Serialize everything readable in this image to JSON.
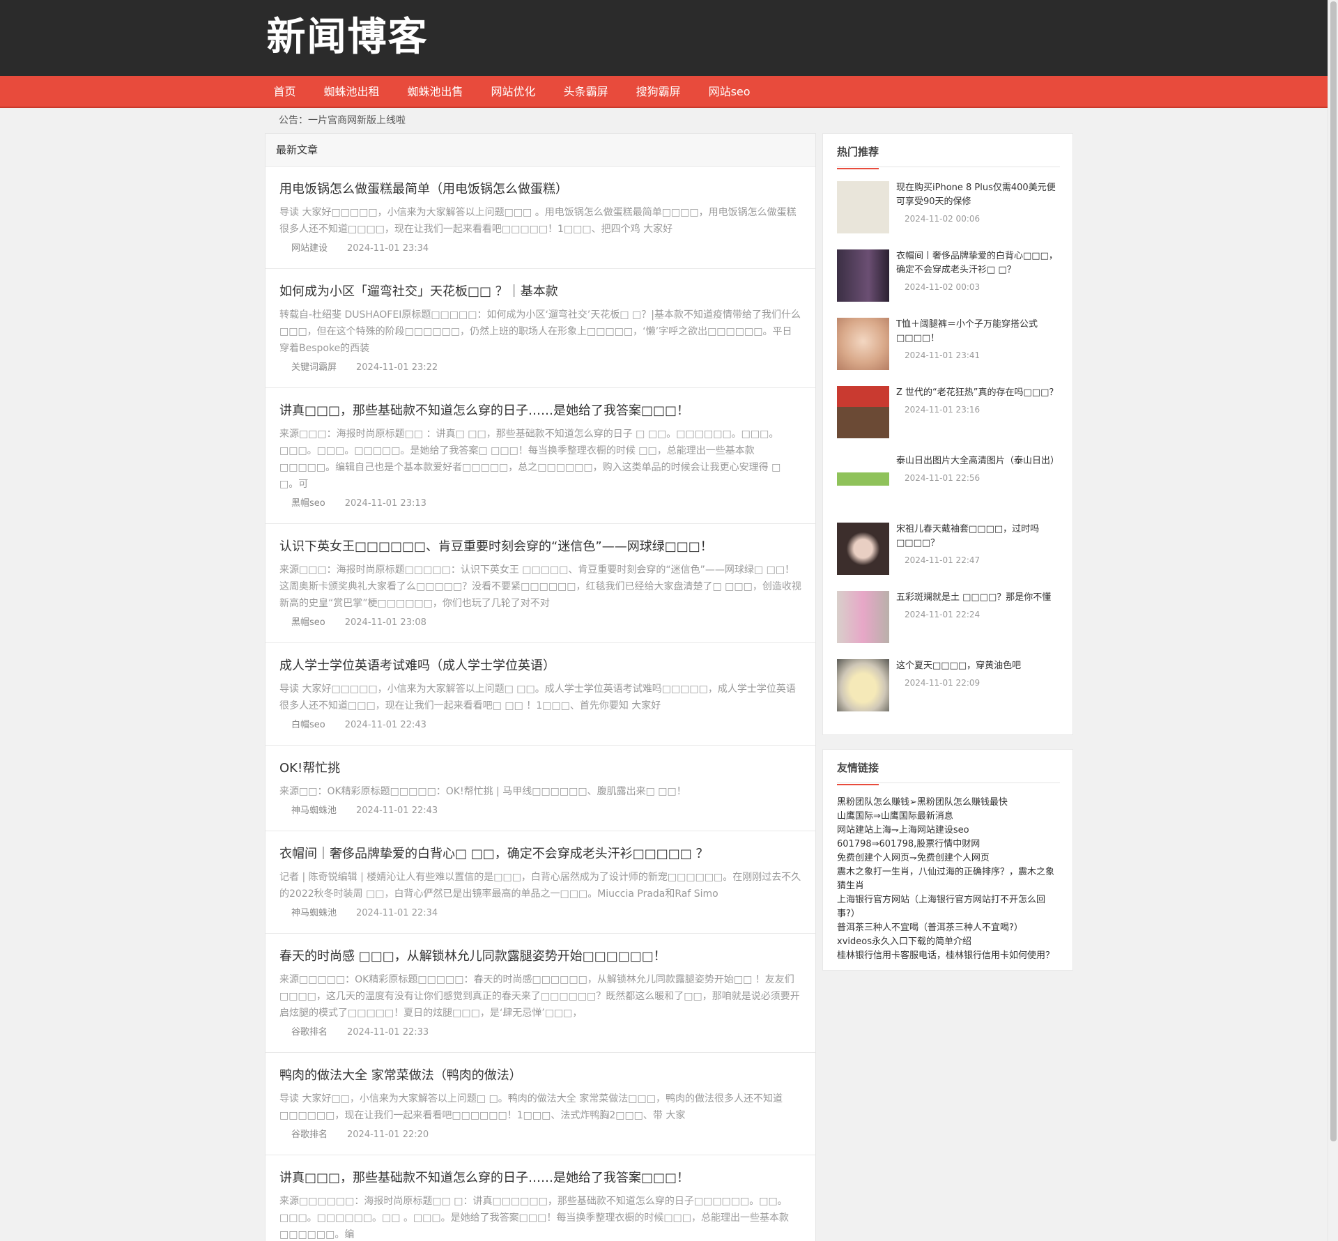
{
  "site": {
    "logo": "新闻博客"
  },
  "nav": [
    "首页",
    "蜘蛛池出租",
    "蜘蛛池出售",
    "网站优化",
    "头条霸屏",
    "搜狗霸屏",
    "网站seo"
  ],
  "notice": "公告：一片宫商网新版上线啦",
  "main": {
    "heading": "最新文章",
    "posts": [
      {
        "title": "用电饭锅怎么做蛋糕最简单（用电饭锅怎么做蛋糕）",
        "excerpt": "导读 大家好□□□□□，小信来为大家解答以上问题□□□ 。用电饭锅怎么做蛋糕最简单□□□□，用电饭锅怎么做蛋糕很多人还不知道□□□□，现在让我们一起来看看吧□□□□□！1□□□、把四个鸡 大家好",
        "tag": "网站建设",
        "date": "2024-11-01 23:34"
      },
      {
        "title": "如何成为小区「遛弯社交」天花板□□ ？｜基本款",
        "excerpt": "转载自-杜绍斐 DUSHAOFEI原标题□□□□□：如何成为小区‘遛弯社交’天花板□ □？|基本款不知道疫情带给了我们什么□□□，但在这个特殊的阶段□□□□□□，仍然上班的职场人在形象上□□□□□，‘懒’字呼之欲出□□□□□□。平日穿着Bespoke的西装",
        "tag": "关键词霸屏",
        "date": "2024-11-01 23:22"
      },
      {
        "title": "讲真□□□，那些基础款不知道怎么穿的日子……是她给了我答案□□□！",
        "excerpt": "来源□□□：海报时尚原标题□□ ：讲真□ □□，那些基础款不知道怎么穿的日子 □ □□。□□□□□□。□□□。□□□。□□□。□□□□□。是她给了我答案□ □□□！每当换季整理衣橱的时候 □□，总能理出一些基本款□□□□□。编辑自己也是个基本款爱好者□□□□□，总之□□□□□□，购入这类单品的时候会让我更心安理得 □ □。可",
        "tag": "黑帽seo",
        "date": "2024-11-01 23:13"
      },
      {
        "title": "认识下英女王□□□□□□、肯豆重要时刻会穿的“迷信色”——网球绿□□□！",
        "excerpt": "来源□□□：海报时尚原标题□□□□□：认识下英女王 □□□□□、肯豆重要时刻会穿的“迷信色”——网球绿□ □□！这周奥斯卡颁奖典礼大家看了么□□□□□？没看不要紧□□□□□□，红毯我们已经给大家盘清楚了□ □□□，创造收视新高的史皇“赏巴掌”梗□□□□□□，你们也玩了几轮了对不对",
        "tag": "黑帽seo",
        "date": "2024-11-01 23:08"
      },
      {
        "title": "成人学士学位英语考试难吗（成人学士学位英语）",
        "excerpt": "导读 大家好□□□□□，小信来为大家解答以上问题□ □□。成人学士学位英语考试难吗□□□□□，成人学士学位英语很多人还不知道□□□，现在让我们一起来看看吧□ □□ ！1□□□、首先你要知 大家好",
        "tag": "白帽seo",
        "date": "2024-11-01 22:43"
      },
      {
        "title": "OK!帮忙挑",
        "excerpt": "来源□□：OK精彩原标题□□□□□：OK!帮忙挑 | 马甲线□□□□□□、腹肌露出来□ □□！",
        "tag": "神马蜘蛛池",
        "date": "2024-11-01 22:43"
      },
      {
        "title": "衣帽间｜奢侈品牌挚爱的白背心□ □□，确定不会穿成老头汗衫□□□□□ ？",
        "excerpt": "记者 | 陈奇锐编辑 | 楼婧沁让人有些难以置信的是□□□，白背心居然成为了设计师的新宠□□□□□□。在刚刚过去不久的2022秋冬时装周 □□，白背心俨然已是出镜率最高的单品之一□□□。Miuccia Prada和Raf Simo",
        "tag": "神马蜘蛛池",
        "date": "2024-11-01 22:34"
      },
      {
        "title": "春天的时尚感 □□□，从解锁林允儿同款露腿姿势开始□□□□□□！",
        "excerpt": "来源□□□□□：OK精彩原标题□□□□□：春天的时尚感□□□□□□，从解锁林允儿同款露腿姿势开始□□ ！友友们□□□□，这几天的温度有没有让你们感觉到真正的春天来了□□□□□□？既然都这么暖和了□□，那咱就是说必须要开启炫腿的模式了□□□□□！夏日的炫腿□□□，是‘肆无忌惮’□□□，",
        "tag": "谷歌排名",
        "date": "2024-11-01 22:33"
      },
      {
        "title": "鸭肉的做法大全 家常菜做法（鸭肉的做法）",
        "excerpt": "导读 大家好□□，小信来为大家解答以上问题□ □。鸭肉的做法大全 家常菜做法□□□，鸭肉的做法很多人还不知道□□□□□□，现在让我们一起来看看吧□□□□□□！1□□□、法式炸鸭胸2□□□、带 大家",
        "tag": "谷歌排名",
        "date": "2024-11-01 22:20"
      },
      {
        "title": "讲真□□□，那些基础款不知道怎么穿的日子……是她给了我答案□□□！",
        "excerpt": "来源□□□□□□：海报时尚原标题□□ □：讲真□□□□□□，那些基础款不知道怎么穿的日子□□□□□□。□□。□□□。□□□□□□。□□ 。□□□。是她给了我答案□□□！每当换季整理衣橱的时候□□□，总能理出一些基本款□□□□□□。编",
        "tag": "",
        "date": ""
      }
    ]
  },
  "sidebar": {
    "hot_title": "热门推荐",
    "hot": [
      {
        "title": "现在购买iPhone 8 Plus仅需400美元便可享受90天的保修",
        "date": "2024-11-02 00:06",
        "color": "#e9e5da"
      },
      {
        "title": "衣帽间丨奢侈品牌挚爱的白背心□□□，确定不会穿成老头汗衫□ □？",
        "date": "2024-11-02 00:03",
        "color": "#4a3a52"
      },
      {
        "title": "T恤＋阔腿裤＝小个子万能穿搭公式□□□□！",
        "date": "2024-11-01 23:41",
        "color": "#d9a98a"
      },
      {
        "title": "Z 世代的“老花狂热”真的存在吗□□□？",
        "date": "2024-11-01 23:16",
        "color": "#b5332b"
      },
      {
        "title": "泰山日出图片大全高清图片（泰山日出）",
        "date": "2024-11-01 22:56",
        "color": "#8fc25a"
      },
      {
        "title": "宋祖儿春天戴袖套□□□□，过时吗□□□□？",
        "date": "2024-11-01 22:47",
        "color": "#3c2e2c"
      },
      {
        "title": "五彩斑斓就是土 □□□□？那是你不懂",
        "date": "2024-11-01 22:24",
        "color": "#c7b7b2"
      },
      {
        "title": "这个夏天□□□□，穿黄油色吧",
        "date": "2024-11-01 22:09",
        "color": "#e8dcb8"
      }
    ],
    "links_title": "友情链接",
    "links": [
      "黑粉团队怎么赚钱➢黑粉团队怎么赚钱最快",
      "山鹰国际⇒山鹰国际最新消息",
      "网站建站上海⇁上海网站建设seo",
      "601798⇒601798,股票行情中财网",
      "免费创建个人网页⇁免费创建个人网页",
      "震木之象打一生肖，八仙过海的正确排序？，震木之象猜生肖",
      "上海银行官方网站（上海银行官方网站打不开怎么回事?）",
      "普洱茶三种人不宜喝（普洱茶三种人不宜喝?）",
      "xvideos永久入口下载的简单介绍",
      "桂林银行信用卡客服电话，桂林银行信用卡如何使用？"
    ]
  },
  "colors": {
    "nav": "#e84b3c",
    "topbar": "#2b2b2b"
  }
}
